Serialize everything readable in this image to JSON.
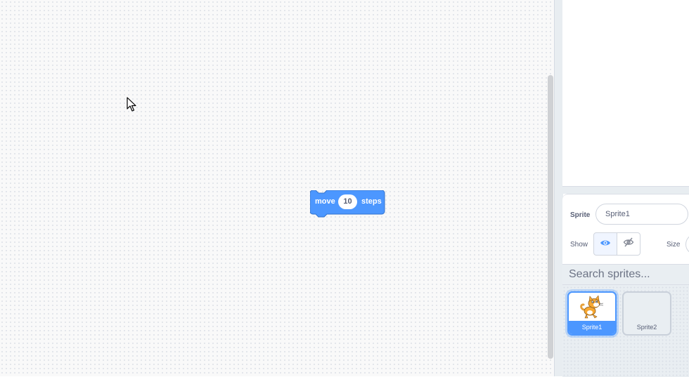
{
  "block": {
    "opcode_text": "move",
    "input_value": "10",
    "suffix_text": "steps",
    "color": "#4c97ff"
  },
  "sprite_info": {
    "sprite_label": "Sprite",
    "sprite_name": "Sprite1",
    "show_label": "Show",
    "size_label": "Size"
  },
  "sprite_list": {
    "search_placeholder": "Search sprites...",
    "sprites": [
      {
        "name": "Sprite1",
        "selected": true,
        "icon": "cat-costume-icon"
      },
      {
        "name": "Sprite2",
        "selected": false,
        "icon": ""
      }
    ]
  },
  "colors": {
    "accent": "#4c97ff",
    "text": "#575e75",
    "panel_bg": "#e9eef2"
  }
}
